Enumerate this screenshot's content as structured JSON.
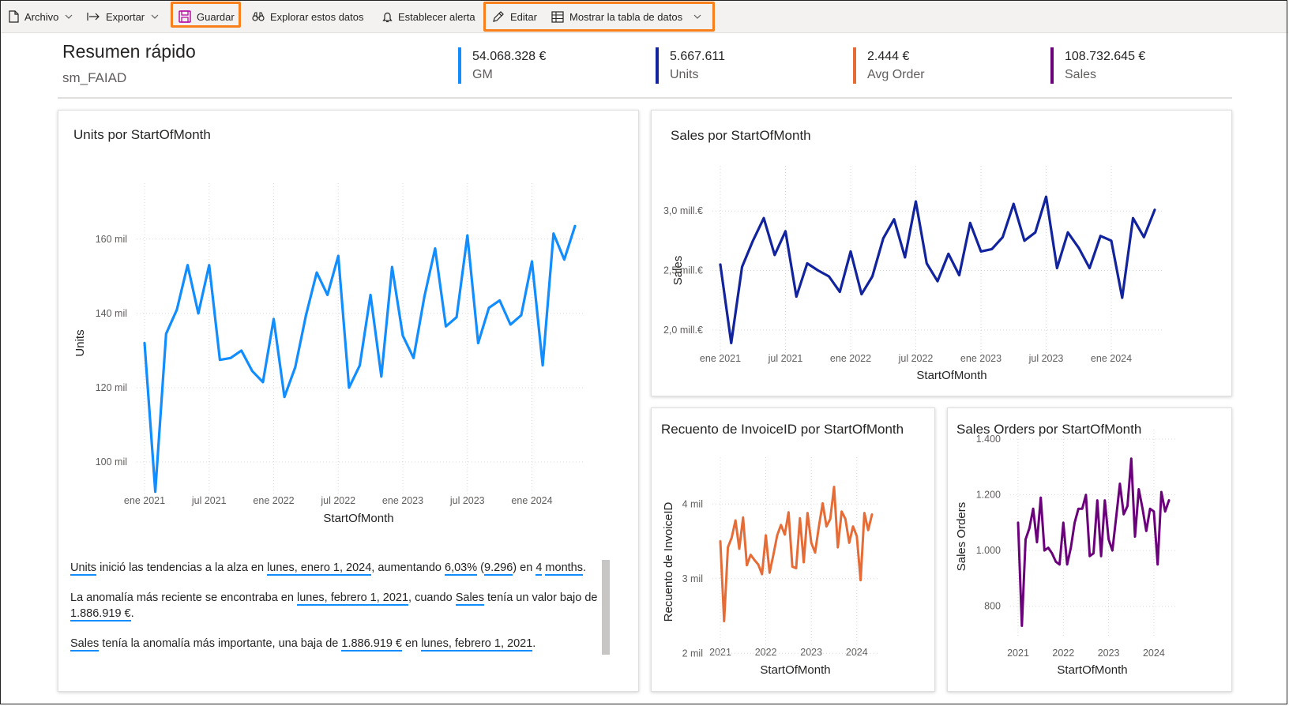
{
  "toolbar": {
    "file": "Archivo",
    "export": "Exportar",
    "save": "Guardar",
    "explore": "Explorar estos datos",
    "alert": "Establecer alerta",
    "edit": "Editar",
    "show_table": "Mostrar la tabla de datos"
  },
  "header": {
    "title": "Resumen rápido",
    "subtitle": "sm_FAIAD"
  },
  "kpis": [
    {
      "value": "54.068.328 €",
      "label": "GM",
      "color": "#118dff"
    },
    {
      "value": "5.667.611",
      "label": "Units",
      "color": "#12239e"
    },
    {
      "value": "2.444 €",
      "label": "Avg Order",
      "color": "#e66c37"
    },
    {
      "value": "108.732.645 €",
      "label": "Sales",
      "color": "#6b007b"
    }
  ],
  "chart_data": [
    {
      "type": "line",
      "title": "Units por StartOfMonth",
      "xlabel": "StartOfMonth",
      "ylabel": "Units",
      "color": "#118dff",
      "x_ticks": [
        "ene 2021",
        "jul 2021",
        "ene 2022",
        "jul 2022",
        "ene 2023",
        "jul 2023",
        "ene 2024"
      ],
      "y_ticks": [
        "100 mil",
        "120 mil",
        "140 mil",
        "160 mil"
      ],
      "x_range": [
        0,
        40
      ],
      "ylim": [
        91500,
        172500
      ],
      "values": [
        132000,
        92000,
        134500,
        141000,
        153000,
        140000,
        153000,
        127500,
        128000,
        130000,
        124500,
        121500,
        138500,
        117500,
        125500,
        139500,
        151000,
        145000,
        155500,
        120000,
        126000,
        145000,
        123000,
        152500,
        134000,
        128000,
        144500,
        157500,
        136500,
        139000,
        161000,
        132000,
        141500,
        143500,
        137000,
        139500,
        154000,
        126000,
        161500,
        154500,
        163500
      ]
    },
    {
      "type": "line",
      "title": "Sales por StartOfMonth",
      "xlabel": "StartOfMonth",
      "ylabel": "Sales",
      "color": "#12239e",
      "x_ticks": [
        "ene 2021",
        "jul 2021",
        "ene 2022",
        "jul 2022",
        "ene 2023",
        "jul 2023",
        "ene 2024"
      ],
      "y_ticks": [
        "2,0 mill.€",
        "2,5 mill.€",
        "3,0 mill.€"
      ],
      "x_range": [
        0,
        40
      ],
      "ylim": [
        1700000,
        3300000
      ],
      "values": [
        2550000,
        1890000,
        2530000,
        2750000,
        2940000,
        2630000,
        2830000,
        2280000,
        2560000,
        2500000,
        2450000,
        2320000,
        2660000,
        2300000,
        2450000,
        2770000,
        2930000,
        2610000,
        3080000,
        2560000,
        2410000,
        2640000,
        2460000,
        2900000,
        2660000,
        2680000,
        2780000,
        3060000,
        2750000,
        2820000,
        3120000,
        2520000,
        2820000,
        2690000,
        2520000,
        2790000,
        2750000,
        2270000,
        2940000,
        2780000,
        3010000
      ]
    },
    {
      "type": "line",
      "title": "Recuento de InvoiceID por StartOfMonth",
      "xlabel": "StartOfMonth",
      "ylabel": "Recuento de InvoiceID",
      "color": "#e66c37",
      "x_ticks": [
        "2021",
        "2022",
        "2023",
        "2024"
      ],
      "y_ticks": [
        "2 mil",
        "3 mil",
        "4 mil"
      ],
      "x_range": [
        0,
        40
      ],
      "ylim": [
        1950,
        4500
      ],
      "values": [
        3500,
        2430,
        3420,
        3550,
        3780,
        3400,
        3820,
        3180,
        3320,
        3250,
        3190,
        3060,
        3580,
        3080,
        3320,
        3580,
        3720,
        3590,
        3890,
        3160,
        3140,
        3810,
        3220,
        3880,
        3480,
        3350,
        3700,
        4010,
        3700,
        3800,
        4230,
        3420,
        3900,
        3800,
        3480,
        3700,
        3570,
        2980,
        3880,
        3650,
        3860
      ]
    },
    {
      "type": "line",
      "title": "Sales Orders por StartOfMonth",
      "xlabel": "StartOfMonth",
      "ylabel": "Sales Orders",
      "color": "#6b007b",
      "x_ticks": [
        "2021",
        "2022",
        "2023",
        "2024"
      ],
      "y_ticks": [
        "800",
        "1.000",
        "1.200",
        "1.400"
      ],
      "x_range": [
        0,
        40
      ],
      "ylim": [
        700,
        1400
      ],
      "values": [
        1100,
        730,
        1040,
        1080,
        1150,
        1030,
        1190,
        1000,
        1010,
        990,
        960,
        950,
        1100,
        950,
        1010,
        1100,
        1150,
        1150,
        1200,
        980,
        990,
        1180,
        980,
        1180,
        1040,
        1000,
        1120,
        1240,
        1130,
        1160,
        1330,
        1050,
        1220,
        1150,
        1070,
        1150,
        1140,
        950,
        1210,
        1140,
        1180
      ]
    }
  ],
  "narrative": {
    "p1": {
      "m1": "Units",
      "t1": " inició las tendencias a la alza en ",
      "m2": "lunes, enero 1, 2024",
      "t2": ", aumentando ",
      "m3": "6,03%",
      "t3": " (",
      "m4": "9.296",
      "t4": ") en ",
      "m5": "4",
      "t5": " ",
      "m6": "months",
      "t6": "."
    },
    "p2": {
      "t1": "La anomalía más reciente se encontraba en ",
      "m1": "lunes, febrero 1, 2021",
      "t2": ", cuando ",
      "m2": "Sales",
      "t3": " tenía un valor bajo de ",
      "m3": "1.886.919 €",
      "t4": "."
    },
    "p3": {
      "m1": "Sales",
      "t1": " tenía la anomalía más importante, una baja de ",
      "m2": "1.886.919 €",
      "t2": " en ",
      "m3": "lunes, febrero 1, 2021",
      "t3": "."
    }
  }
}
